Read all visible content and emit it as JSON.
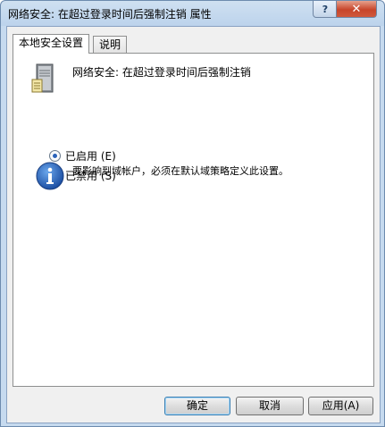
{
  "window": {
    "title": "网络安全: 在超过登录时间后强制注销 属性",
    "help_label": "?",
    "close_label": "✕"
  },
  "tabs": [
    {
      "label": "本地安全设置",
      "active": true
    },
    {
      "label": "说明",
      "active": false
    }
  ],
  "policy": {
    "icon": "server-icon",
    "title": "网络安全: 在超过登录时间后强制注销"
  },
  "options": [
    {
      "label": "已启用 (E)",
      "checked": true
    },
    {
      "label": "已禁用 (S)",
      "checked": false
    }
  ],
  "info": {
    "icon": "info-icon",
    "text": "要影响到域帐户，必须在默认域策略定义此设置。"
  },
  "buttons": {
    "ok": "确定",
    "cancel": "取消",
    "apply": "应用(A)"
  },
  "colors": {
    "accent": "#2a62b9",
    "close": "#c7452b",
    "frame": "#c6daef"
  }
}
